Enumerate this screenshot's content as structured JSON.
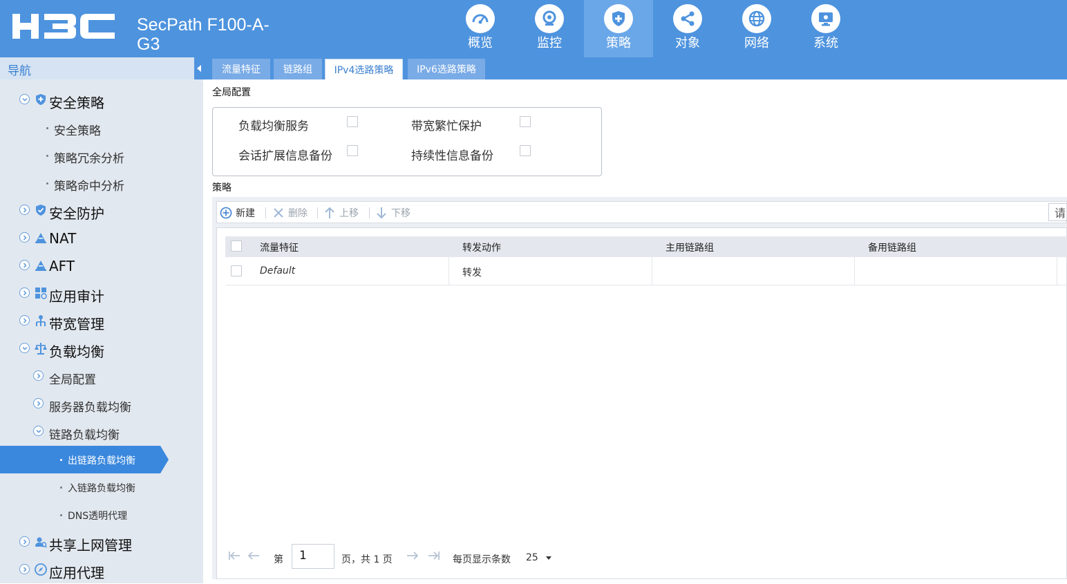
{
  "header": {
    "logo_text": "H3C",
    "product_line1": "SecPath F100-A-",
    "product_line2": "G3",
    "nav": [
      {
        "label": "概览",
        "icon": "dashboard-gauge-icon"
      },
      {
        "label": "监控",
        "icon": "monitor-camera-icon"
      },
      {
        "label": "策略",
        "icon": "shield-icon",
        "active": true
      },
      {
        "label": "对象",
        "icon": "share-nodes-icon"
      },
      {
        "label": "网络",
        "icon": "globe-icon"
      },
      {
        "label": "系统",
        "icon": "computer-monitor-icon"
      }
    ]
  },
  "sidebar": {
    "title": "导航",
    "items": [
      {
        "label": "安全策略",
        "level": 1
      },
      {
        "label": "安全策略",
        "level": 2
      },
      {
        "label": "策略冗余分析",
        "level": 2
      },
      {
        "label": "策略命中分析",
        "level": 2
      },
      {
        "label": "安全防护",
        "level": 1
      },
      {
        "label": "NAT",
        "level": 1
      },
      {
        "label": "AFT",
        "level": 1
      },
      {
        "label": "应用审计",
        "level": 1
      },
      {
        "label": "带宽管理",
        "level": 1
      },
      {
        "label": "负载均衡",
        "level": 1
      },
      {
        "label": "全局配置",
        "level": 2
      },
      {
        "label": "服务器负载均衡",
        "level": 2
      },
      {
        "label": "链路负载均衡",
        "level": 2
      },
      {
        "label": "出链路负载均衡",
        "level": 3,
        "active": true
      },
      {
        "label": "入链路负载均衡",
        "level": 3
      },
      {
        "label": "DNS透明代理",
        "level": 3
      },
      {
        "label": "共享上网管理",
        "level": 1
      },
      {
        "label": "应用代理",
        "level": 1
      }
    ]
  },
  "tabs": [
    {
      "label": "流量特征"
    },
    {
      "label": "链路组"
    },
    {
      "label": "IPv4选路策略",
      "active": true
    },
    {
      "label": "IPv6选路策略"
    }
  ],
  "global_config": {
    "title": "全局配置",
    "options": [
      {
        "label": "负载均衡服务",
        "checked": false
      },
      {
        "label": "带宽繁忙保护",
        "checked": false
      },
      {
        "label": "会话扩展信息备份",
        "checked": false
      },
      {
        "label": "持续性信息备份",
        "checked": false
      }
    ]
  },
  "policy": {
    "title": "策略",
    "toolbar": {
      "new_label": "新建",
      "delete_label": "删除",
      "move_up_label": "上移",
      "move_down_label": "下移",
      "search_placeholder": "请"
    },
    "columns": [
      "流量特征",
      "转发动作",
      "主用链路组",
      "备用链路组"
    ],
    "rows": [
      {
        "traffic": "Default",
        "action": "转发",
        "primary": "",
        "backup": ""
      }
    ],
    "pager": {
      "page_prefix": "第",
      "current_page": "1",
      "page_suffix": "页，共 1 页",
      "per_page_label": "每页显示条数",
      "per_page_value": "25"
    }
  },
  "colors": {
    "brand_blue": "#4e93de",
    "active_nav": "#6aa7e8",
    "sidebar_bg": "#e2e8ef",
    "sidebar_active": "#3a88de"
  }
}
